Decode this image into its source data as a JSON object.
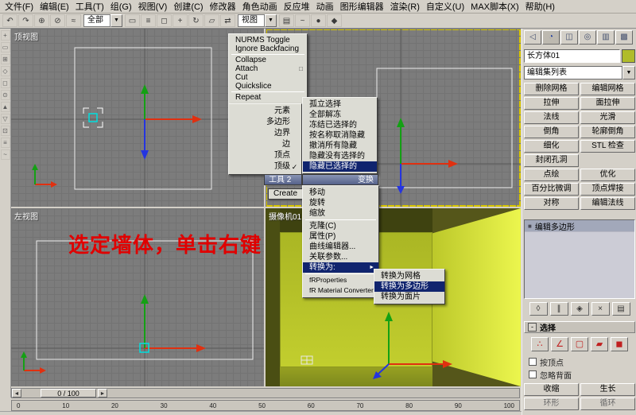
{
  "menu_bar": {
    "items": [
      "文件(F)",
      "编辑(E)",
      "工具(T)",
      "组(G)",
      "视图(V)",
      "创建(C)",
      "修改器",
      "角色动画",
      "反应堆",
      "动画",
      "图形编辑器",
      "渲染(R)",
      "自定义(U)",
      "MAX脚本(X)",
      "帮助(H)"
    ]
  },
  "toolbar": {
    "selection_filter": "全部",
    "coord_system": "视图"
  },
  "viewports": {
    "top_left_label": "顶视图",
    "bottom_left_label": "左视图",
    "camera_label": "摄像机01"
  },
  "annotation": {
    "text": "选定墙体，单击右键",
    "color": "#e00000"
  },
  "quad_menu": {
    "tools1_items": [
      "NURMS Toggle",
      "Ignore Backfacing",
      "Collapse",
      "Attach",
      "Cut",
      "Quickslice",
      "Repeat"
    ],
    "subobject_items": [
      "元素",
      "多边形",
      "边界",
      "边",
      "顶点",
      "顶级"
    ],
    "subobject_checked": "顶级",
    "display_items": [
      "孤立选择",
      "全部解冻",
      "冻结已选择的",
      "按名称取消隐藏",
      "撤消所有隐藏",
      "隐藏没有选择的",
      "隐藏已选择的"
    ],
    "display_highlighted": "隐藏已选择的",
    "header_tools2": "工具 2",
    "header_transform": "变换",
    "create_label": "Create",
    "transform_items": [
      "移动",
      "旋转",
      "缩放",
      "克隆(C)",
      "属性(P)",
      "曲线编辑器...",
      "关联参数...",
      "转换为:",
      "fRProperties",
      "fR Material Converter"
    ],
    "transform_highlighted": "转换为:",
    "convert_submenu": [
      "转换为网格",
      "转换为多边形",
      "转换为面片"
    ],
    "convert_highlighted": "转换为多边形"
  },
  "command_panel": {
    "object_name": "长方体01",
    "object_color": "#b0bc2a",
    "object_color_style": "background:#b0bc2a",
    "modifier_list_label": "编辑集列表",
    "modifier_buttons": [
      "删除网格",
      "编辑网格",
      "拉伸",
      "面拉伸",
      "法线",
      "光滑",
      "倒角",
      "轮廓倒角",
      "细化",
      "STL 检查",
      "封闭孔洞",
      "点绘",
      "优化",
      "百分比微调",
      "顶点焊接",
      "对称",
      "编辑法线"
    ],
    "stack_item": "编辑多边形",
    "selection": {
      "title": "选择",
      "checkbox_by_vertex": "按顶点",
      "checkbox_ignore_backfacing": "忽略背面",
      "btn_shrink": "收缩",
      "btn_grow": "生长",
      "btn_ring": "环形",
      "btn_loop": "循环"
    }
  },
  "timeline": {
    "slider_label": "0 / 100",
    "ticks": [
      "0",
      "10",
      "20",
      "30",
      "40",
      "50",
      "60",
      "70",
      "80",
      "90",
      "100"
    ]
  },
  "colors": {
    "menu_highlight": "#10246e",
    "active_viewport_border": "#d8c600",
    "viewport_grey": "#7c7c7c"
  },
  "icons": {
    "dropdown_arrow": "▼",
    "check": "✓",
    "submenu_arrow": "►",
    "settings_box": "□",
    "slider_left": "◄",
    "slider_right": "►",
    "stack_bullet": "■",
    "rollout_minus": "-",
    "toolbar_glyphs": [
      "↶",
      "↷",
      "⊕",
      "⊘",
      "≈",
      "▭",
      "≡",
      "◻",
      "+",
      "↻",
      "▱",
      "⇄",
      "▤",
      "~",
      "●",
      "◆"
    ],
    "leftbar_glyphs": [
      "+",
      "▭",
      "⊞",
      "◇",
      "◻",
      "⊙",
      "▲",
      "▽",
      "⊡",
      "≡",
      "~"
    ],
    "panel_tab_glyphs": [
      "◁",
      "◔",
      "◫",
      "◎",
      "▥",
      "▩"
    ],
    "stack_toolbar_glyphs": [
      "◊",
      "∥",
      "◈",
      "×",
      "▤"
    ],
    "subobject_glyphs": [
      "∴",
      "∠",
      "▢",
      "▰",
      "◼"
    ]
  }
}
